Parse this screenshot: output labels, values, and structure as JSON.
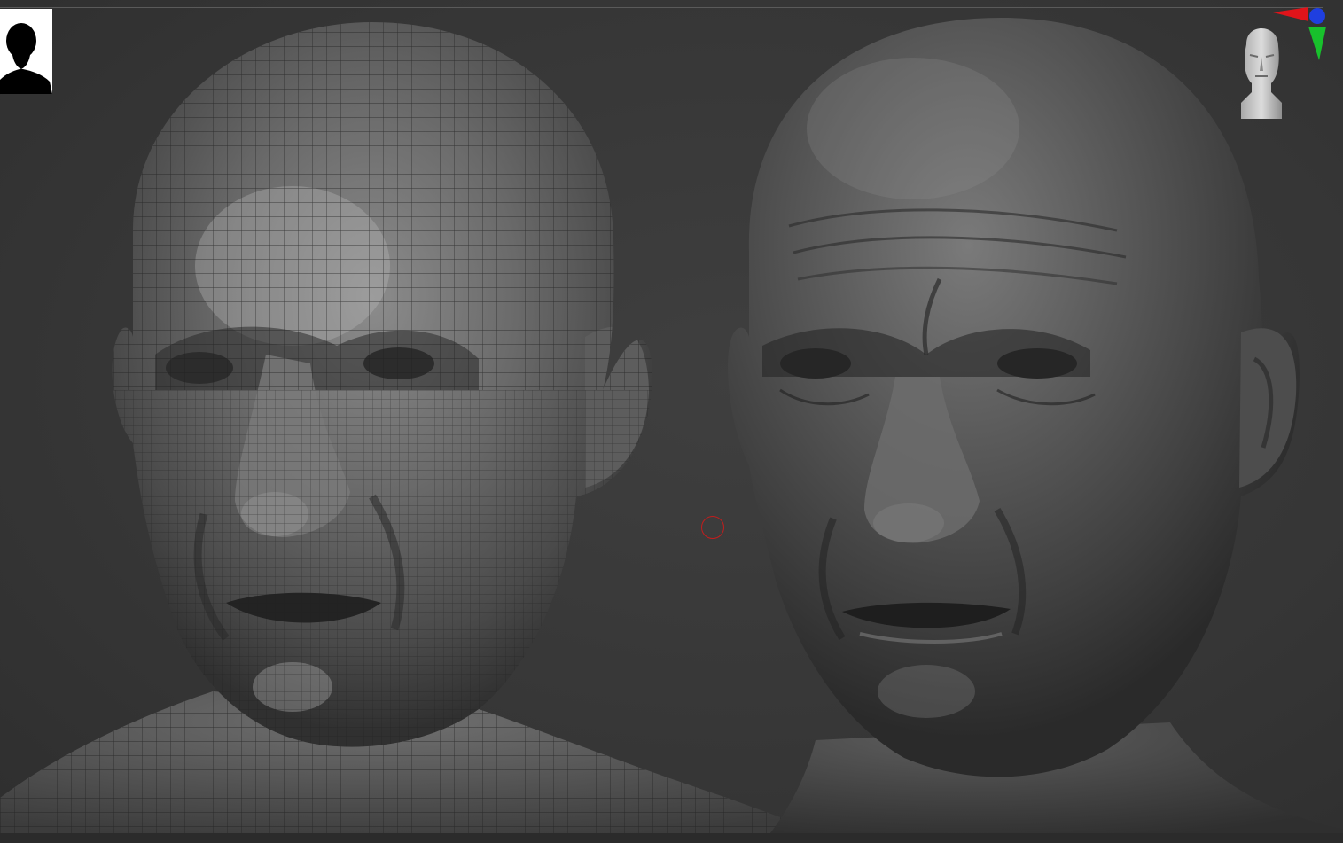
{
  "app": {
    "viewport": "3d-sculpt-viewport"
  },
  "icons": {
    "document_thumbnail": "person-silhouette-icon",
    "axis_gizmo": "xyz-axis-icon",
    "navigation_head": "head-orientation-icon",
    "brush_cursor": "brush-cursor-icon"
  },
  "colors": {
    "background": "#3a3a3a",
    "axis_x": "#e0141a",
    "axis_y": "#18c12c",
    "axis_z": "#1f3fe0",
    "cursor": "#c21d1d"
  }
}
